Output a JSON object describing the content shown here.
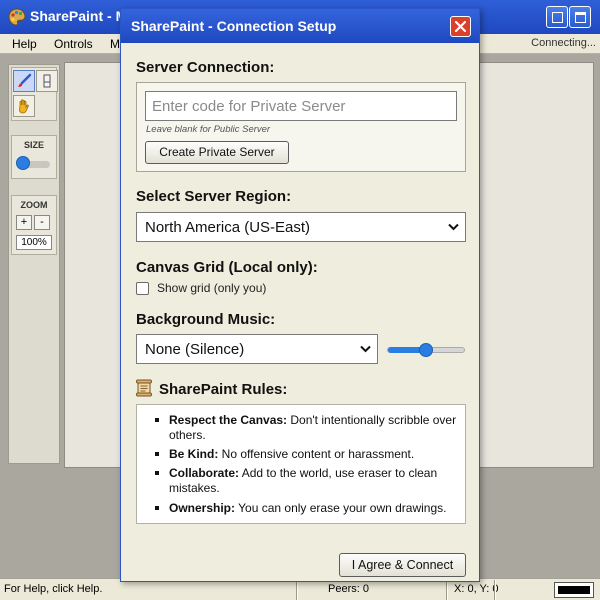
{
  "app": {
    "title": "SharePaint - M",
    "menu": {
      "help": "Help",
      "controls": "Ontrols",
      "m": "M"
    },
    "connection_status": "Connecting...",
    "toolbox": {
      "size_label": "SIZE",
      "zoom_label": "ZOOM",
      "zoom_in": "+",
      "zoom_out": "-",
      "zoom_level": "100%"
    },
    "statusbar": {
      "help_text": "For Help, click Help.",
      "peers": "Peers: 0",
      "coords": "X: 0, Y: 0",
      "current_color": "#000000"
    }
  },
  "dialog": {
    "title": "SharePaint - Connection Setup",
    "server": {
      "heading": "Server Connection:",
      "input_placeholder": "Enter code for Private Server",
      "input_value": "",
      "hint": "Leave blank for Public Server",
      "create_button": "Create Private Server"
    },
    "region": {
      "heading": "Select Server Region:",
      "selected": "North America (US-East)"
    },
    "grid": {
      "heading": "Canvas Grid (Local only):",
      "checkbox_label": "Show grid (only you)",
      "checked": false
    },
    "music": {
      "heading": "Background Music:",
      "selected": "None (Silence)",
      "volume": 0.5
    },
    "rules": {
      "heading": "SharePaint Rules:",
      "items": [
        {
          "title": "Respect the Canvas:",
          "text": " Don't intentionally scribble over others."
        },
        {
          "title": "Be Kind:",
          "text": " No offensive content or harassment."
        },
        {
          "title": "Collaborate:",
          "text": " Add to the world, use eraser to clean mistakes."
        },
        {
          "title": "Ownership:",
          "text": " You can only erase your own drawings."
        }
      ]
    },
    "agree_button": "I Agree & Connect"
  },
  "colors": {
    "titlebar": "#1f48c0",
    "close_button": "#d9412e",
    "accent": "#2a7de1",
    "dialog_bg": "#efedde"
  }
}
